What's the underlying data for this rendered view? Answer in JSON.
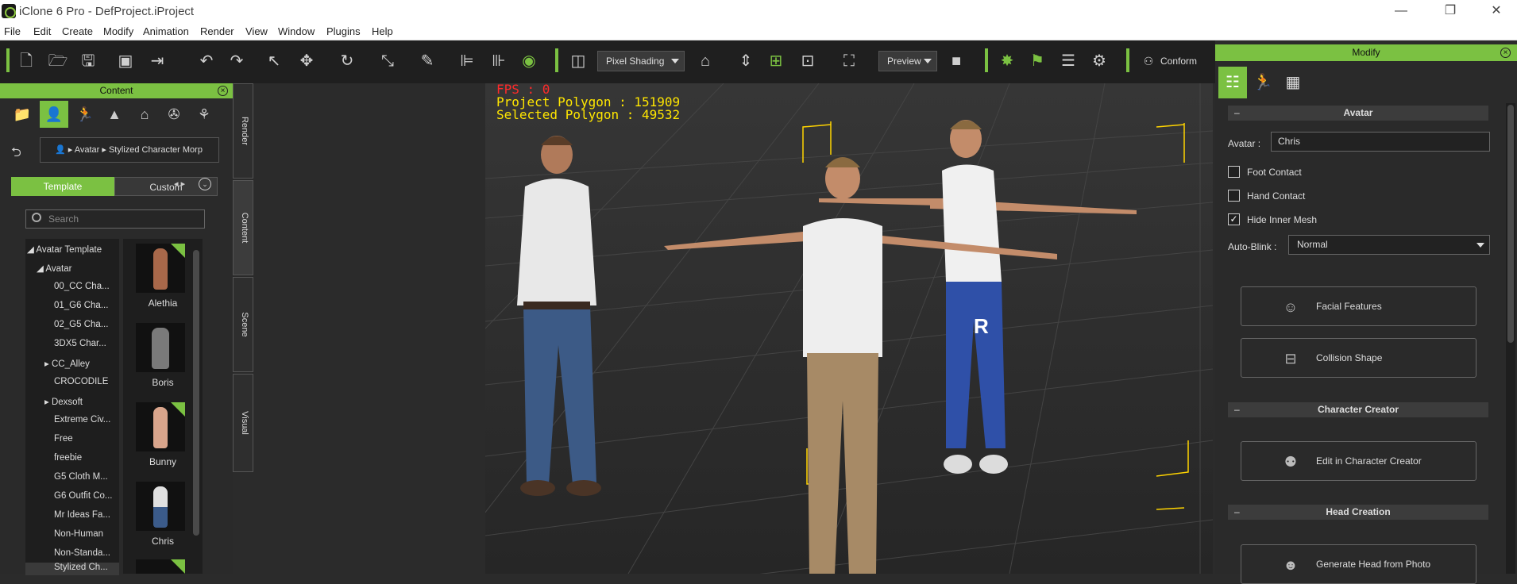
{
  "window": {
    "title": "iClone 6 Pro - DefProject.iProject"
  },
  "menu": [
    "File",
    "Edit",
    "Create",
    "Modify",
    "Animation",
    "Render",
    "View",
    "Window",
    "Plugins",
    "Help"
  ],
  "toolbar": {
    "shading": "Pixel Shading",
    "preview": "Preview",
    "conform": "Conform"
  },
  "content_panel": {
    "title": "Content",
    "breadcrumb": [
      "Avatar",
      "Stylized Character Morp"
    ],
    "tab_template": "Template",
    "tab_custom": "Custom",
    "search_placeholder": "Search",
    "tree": [
      "Avatar Template",
      "Avatar",
      "00_CC Cha...",
      "01_G6 Cha...",
      "02_G5 Cha...",
      "3DX5 Char...",
      "CC_Alley",
      "CROCODILE",
      "Dexsoft",
      "Extreme Civ...",
      "Free",
      "freebie",
      "G5 Cloth M...",
      "G6 Outfit Co...",
      "Mr Ideas Fa...",
      "Non-Human",
      "Non-Standa...",
      "Stylized Ch..."
    ],
    "thumbnails": [
      "Alethia",
      "Boris",
      "Bunny",
      "Chris"
    ],
    "trial_badge": "Trial"
  },
  "vertical_tabs": [
    "Render",
    "Content",
    "Scene",
    "Visual"
  ],
  "viewport": {
    "fps": "FPS : 0",
    "project_polygon": "Project Polygon : 151909",
    "selected_polygon": "Selected Polygon : 49532"
  },
  "modify_panel": {
    "title": "Modify",
    "avatar_section": "Avatar",
    "avatar_label": "Avatar :",
    "avatar_value": "Chris",
    "foot_contact": "Foot Contact",
    "hand_contact": "Hand Contact",
    "hide_inner_mesh": "Hide Inner Mesh",
    "hide_inner_mesh_checked": true,
    "auto_blink_label": "Auto-Blink :",
    "auto_blink_value": "Normal",
    "facial_features": "Facial Features",
    "collision_shape": "Collision Shape",
    "character_creator_section": "Character Creator",
    "edit_in_cc": "Edit in Character Creator",
    "head_creation_section": "Head Creation",
    "generate_head": "Generate Head from Photo"
  },
  "colors": {
    "accent": "#7bc142",
    "stat_text": "#ffe600",
    "fps_text": "#ff2a2a"
  }
}
